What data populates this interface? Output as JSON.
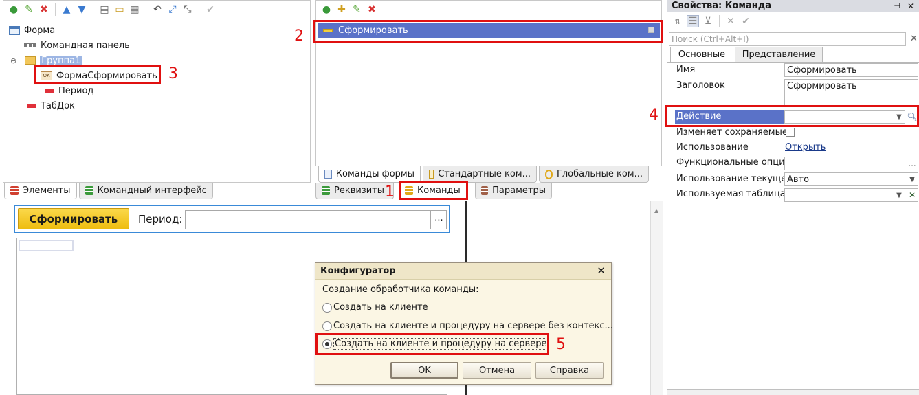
{
  "left_panel": {
    "tree": {
      "root": "Форма",
      "command_bar": "Командная панель",
      "group": "Группа1",
      "form_button": "ФормаСформировать",
      "period": "Период",
      "tabdoc": "ТабДок"
    },
    "tabs": {
      "elements": "Элементы",
      "command_interface": "Командный интерфейс"
    }
  },
  "mid_panel": {
    "command_item": "Сформировать",
    "subtabs": [
      "Команды формы",
      "Стандартные ком...",
      "Глобальные ком..."
    ],
    "tabs": {
      "requisites": "Реквизиты",
      "commands": "Команды",
      "parameters": "Параметры"
    }
  },
  "properties": {
    "title": "Свойства: Команда",
    "search_placeholder": "Поиск (Ctrl+Alt+I)",
    "tabs": {
      "main": "Основные",
      "view": "Представление"
    },
    "rows": {
      "name_label": "Имя",
      "name_value": "Сформировать",
      "header_label": "Заголовок",
      "header_value": "Сформировать",
      "action_label": "Действие",
      "changes_saved_label": "Изменяет сохраняемые",
      "usage_label": "Использование",
      "usage_link": "Открыть",
      "func_options_label": "Функциональные опции",
      "current_usage_label": "Использование текуще",
      "current_usage_value": "Авто",
      "used_table_label": "Используемая таблица"
    }
  },
  "preview": {
    "button": "Сформировать",
    "period_label": "Период:",
    "ellipsis": "..."
  },
  "dialog": {
    "title": "Конфигуратор",
    "prompt": "Создание обработчика команды:",
    "options": [
      "Создать на клиенте",
      "Создать на клиенте и процедуру на сервере без контекс...",
      "Создать на клиенте и процедуру на сервере"
    ],
    "selected_index": 2,
    "ok": "OK",
    "cancel": "Отмена",
    "help": "Справка"
  },
  "annotations": {
    "a1": "1",
    "a2": "2",
    "a3": "3",
    "a4": "4",
    "a5": "5"
  },
  "colors": {
    "selection": "#5a72c8",
    "annotation_red": "#e01010",
    "accent_button": "#f5c518"
  }
}
